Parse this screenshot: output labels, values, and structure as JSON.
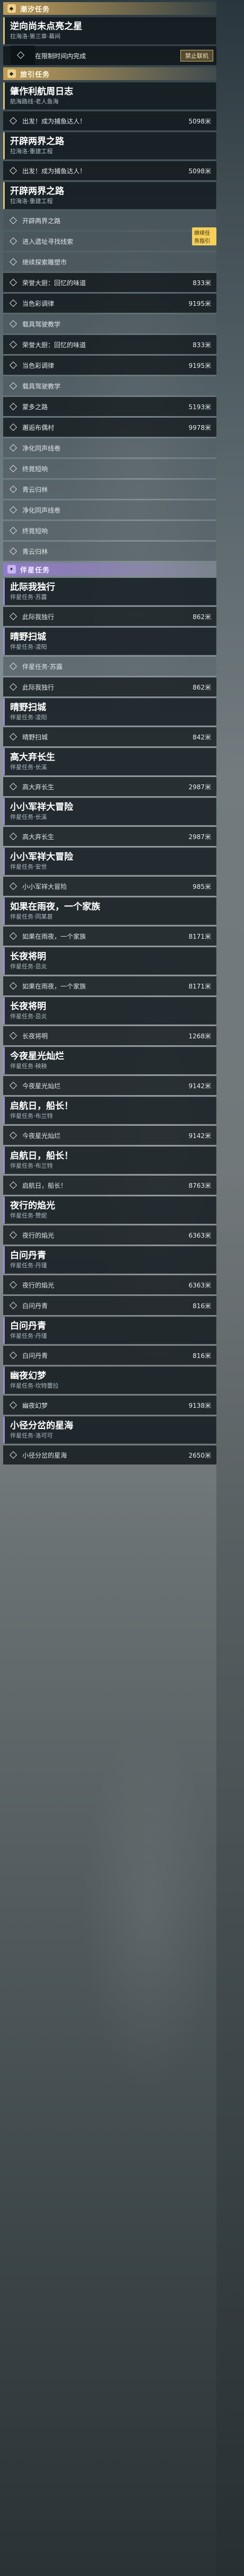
{
  "sections": {
    "tide": "潮汐任务",
    "travel": "旅引任务",
    "companion": "伴星任务"
  },
  "tide_quest": {
    "title": "逆向尚未点亮之星",
    "sub": "拉海洛·第三章·幕间",
    "objective": "在限制时间内完成",
    "button": "禁止联机"
  },
  "travel": [
    {
      "title": "肇作利航周日志",
      "sub": "航海路线·老人鱼海",
      "objectives": [
        {
          "text": "出发！成为捕鱼达人！",
          "dist": "5098米"
        }
      ]
    },
    {
      "title": "开辟两界之路",
      "sub": "拉海洛·重建工程",
      "objectives": [
        {
          "text": "出发！成为捕鱼达人！",
          "dist": "5098米"
        }
      ]
    },
    {
      "title": "开辟两界之路",
      "sub": "拉海洛·重建工程",
      "objectives": [
        {
          "text": "开辟两界之路"
        },
        {
          "text": "进入遗址寻找线索",
          "tag": "继续任务指引"
        },
        {
          "text": "继续探索雕塑市"
        },
        {
          "text": "荣誉大厨：回忆的味道",
          "dist": "833米"
        },
        {
          "text": "当色彩调律",
          "dist": "9195米"
        },
        {
          "text": "载具驾驶教学"
        },
        {
          "text": "荣誉大厨：回忆的味道",
          "dist": "833米"
        },
        {
          "text": "当色彩调律",
          "dist": "9195米"
        },
        {
          "text": "载具驾驶教学"
        },
        {
          "text": "蒙多之路",
          "dist": "5193米"
        },
        {
          "text": "邂逅布偶村",
          "dist": "9978米"
        },
        {
          "text": "净化同声线卷"
        },
        {
          "text": "终竟短响"
        },
        {
          "text": "青云归林"
        },
        {
          "text": "净化同声线卷"
        },
        {
          "text": "终竟短响"
        },
        {
          "text": "青云归林"
        }
      ]
    }
  ],
  "companion": [
    {
      "title": "此际我独行",
      "sub": "伴星任务·苏露",
      "objectives": [
        {
          "text": "此际我独行",
          "dist": "862米"
        }
      ]
    },
    {
      "title": "晴野扫城",
      "sub": "伴星任务·凌阳",
      "objectives": [
        {
          "text": "伴星任务·苏露"
        },
        {
          "text": "此际我独行",
          "dist": "862米"
        }
      ]
    },
    {
      "title": "晴野扫城",
      "sub": "伴星任务·凌阳",
      "objectives": [
        {
          "text": "晴野扫城",
          "dist": "842米"
        }
      ]
    },
    {
      "title": "高大弃长生",
      "sub": "伴星任务·长溪",
      "objectives": [
        {
          "text": "高大弃长生",
          "dist": "2987米"
        }
      ]
    },
    {
      "title": "小小军祥大冒险",
      "sub": "伴星任务·长溪",
      "objectives": [
        {
          "text": "高大弃长生",
          "dist": "2987米"
        }
      ]
    },
    {
      "title": "小小军祥大冒险",
      "sub": "伴星任务·安世",
      "objectives": [
        {
          "text": "小小军祥大冒险",
          "dist": "985米"
        }
      ]
    },
    {
      "title": "如果在雨夜，一个家族",
      "sub": "伴星任务·同某甚",
      "objectives": [
        {
          "text": "如果在雨夜，一个家族",
          "dist": "8171米"
        }
      ]
    },
    {
      "title": "长夜将明",
      "sub": "伴星任务·忌炎",
      "objectives": [
        {
          "text": "如果在雨夜，一个家族",
          "dist": "8171米"
        }
      ]
    },
    {
      "title": "长夜将明",
      "sub": "伴星任务·忌炎",
      "objectives": [
        {
          "text": "长夜将明",
          "dist": "1268米"
        }
      ]
    },
    {
      "title": "今夜星光灿烂",
      "sub": "伴星任务·秧秧",
      "objectives": [
        {
          "text": "今夜星光灿烂",
          "dist": "9142米"
        }
      ]
    },
    {
      "title": "启航日，船长！",
      "sub": "伴星任务·布兰特",
      "objectives": [
        {
          "text": "今夜星光灿烂",
          "dist": "9142米"
        }
      ]
    },
    {
      "title": "启航日，船长！",
      "sub": "伴星任务·布兰特",
      "objectives": [
        {
          "text": "启航日，船长！",
          "dist": "8763米"
        }
      ]
    },
    {
      "title": "夜行的焰光",
      "sub": "伴星任务·赞妮",
      "objectives": [
        {
          "text": "夜行的焰光",
          "dist": "6363米"
        }
      ]
    },
    {
      "title": "白问丹青",
      "sub": "伴星任务·丹瑾",
      "objectives": [
        {
          "text": "夜行的焰光",
          "dist": "6363米"
        },
        {
          "text": "白问丹青",
          "dist": "816米"
        }
      ]
    },
    {
      "title": "白问丹青",
      "sub": "伴星任务·丹瑾",
      "objectives": [
        {
          "text": "白问丹青",
          "dist": "816米"
        }
      ]
    },
    {
      "title": "幽夜幻梦",
      "sub": "伴星任务·坎特蕾拉",
      "objectives": [
        {
          "text": "幽夜幻梦",
          "dist": "9138米"
        }
      ]
    },
    {
      "title": "小径分岔的星海",
      "sub": "伴星任务·洛可可",
      "objectives": [
        {
          "text": "小径分岔的星海",
          "dist": "2650米"
        }
      ]
    }
  ]
}
